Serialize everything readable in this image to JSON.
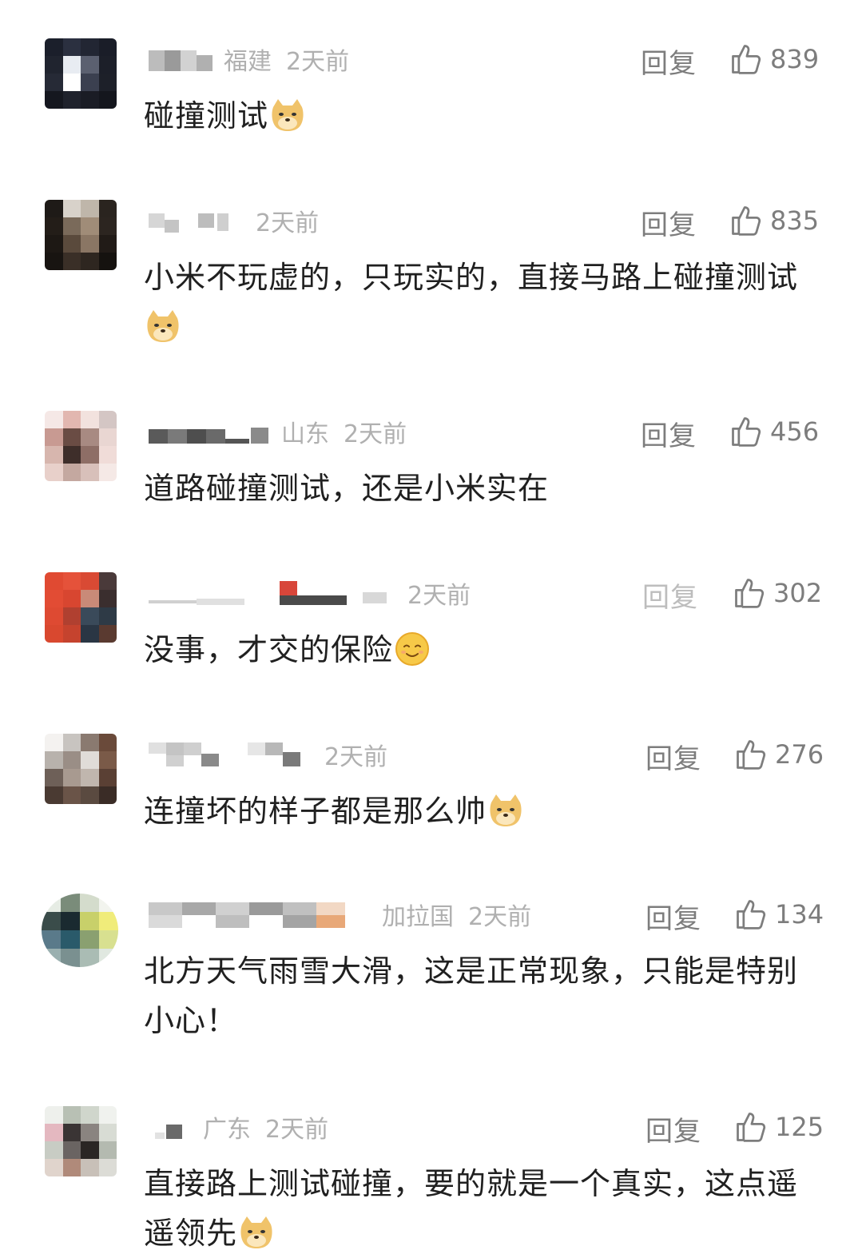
{
  "comments": [
    {
      "region": "福建",
      "time": "2天前",
      "reply_label": "回复",
      "likes": "839",
      "text": "碰撞测试",
      "emoji": "doge-emoji"
    },
    {
      "region": "",
      "time": "2天前",
      "reply_label": "回复",
      "likes": "835",
      "text": "小米不玩虚的，只玩实的，直接马路上碰撞测试",
      "emoji": "doge-emoji"
    },
    {
      "region": "山东",
      "time": "2天前",
      "reply_label": "回复",
      "likes": "456",
      "text": "道路碰撞测试，还是小米实在",
      "emoji": ""
    },
    {
      "region": "",
      "time": "2天前",
      "reply_label": "回复",
      "likes": "302",
      "text": "没事，才交的保险",
      "emoji": "smile-emoji"
    },
    {
      "region": "",
      "time": "2天前",
      "reply_label": "回复",
      "likes": "276",
      "text": "连撞坏的样子都是那么帅",
      "emoji": "doge-emoji"
    },
    {
      "region": "加拉国",
      "time": "2天前",
      "reply_label": "回复",
      "likes": "134",
      "text": "北方天气雨雪大滑，这是正常现象，只能是特别小心！",
      "emoji": ""
    },
    {
      "region": "广东",
      "time": "2天前",
      "reply_label": "回复",
      "likes": "125",
      "text": "直接路上测试碰撞，要的就是一个真实，这点遥遥领先",
      "emoji": "doge-emoji"
    }
  ],
  "colors": {
    "text": "#202020",
    "meta": "#b0b0b0",
    "action": "#7d7d7d"
  }
}
